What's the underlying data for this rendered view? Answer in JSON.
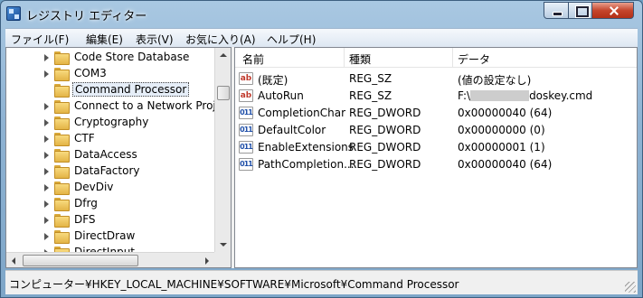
{
  "window": {
    "title": "レジストリ エディター"
  },
  "menu": [
    {
      "label": "ファイル(F)"
    },
    {
      "label": "編集(E)"
    },
    {
      "label": "表示(V)"
    },
    {
      "label": "お気に入り(A)"
    },
    {
      "label": "ヘルプ(H)"
    }
  ],
  "tree": {
    "items": [
      {
        "label": "Code Store Database"
      },
      {
        "label": "COM3"
      },
      {
        "label": "Command Processor"
      },
      {
        "label": "Connect to a Network Projec"
      },
      {
        "label": "Cryptography"
      },
      {
        "label": "CTF"
      },
      {
        "label": "DataAccess"
      },
      {
        "label": "DataFactory"
      },
      {
        "label": "DevDiv"
      },
      {
        "label": "Dfrg"
      },
      {
        "label": "DFS"
      },
      {
        "label": "DirectDraw"
      },
      {
        "label": "DirectInput"
      }
    ],
    "selected": "Command Processor"
  },
  "columns": {
    "name": "名前",
    "type": "種類",
    "data": "データ"
  },
  "values": [
    {
      "icon": "string-value-icon",
      "name": "(既定)",
      "type": "REG_SZ",
      "data": "(値の設定なし)"
    },
    {
      "icon": "string-value-icon",
      "name": "AutoRun",
      "type": "REG_SZ",
      "data_prefix": "F:\\",
      "data_suffix": "doskey.cmd"
    },
    {
      "icon": "binary-value-icon",
      "name": "CompletionChar",
      "type": "REG_DWORD",
      "data": "0x00000040 (64)"
    },
    {
      "icon": "binary-value-icon",
      "name": "DefaultColor",
      "type": "REG_DWORD",
      "data": "0x00000000 (0)"
    },
    {
      "icon": "binary-value-icon",
      "name": "EnableExtensions",
      "type": "REG_DWORD",
      "data": "0x00000001 (1)"
    },
    {
      "icon": "binary-value-icon",
      "name": "PathCompletion...",
      "type": "REG_DWORD",
      "data": "0x00000040 (64)"
    }
  ],
  "status": {
    "path": "コンピューター¥HKEY_LOCAL_MACHINE¥SOFTWARE¥Microsoft¥Command Processor"
  }
}
